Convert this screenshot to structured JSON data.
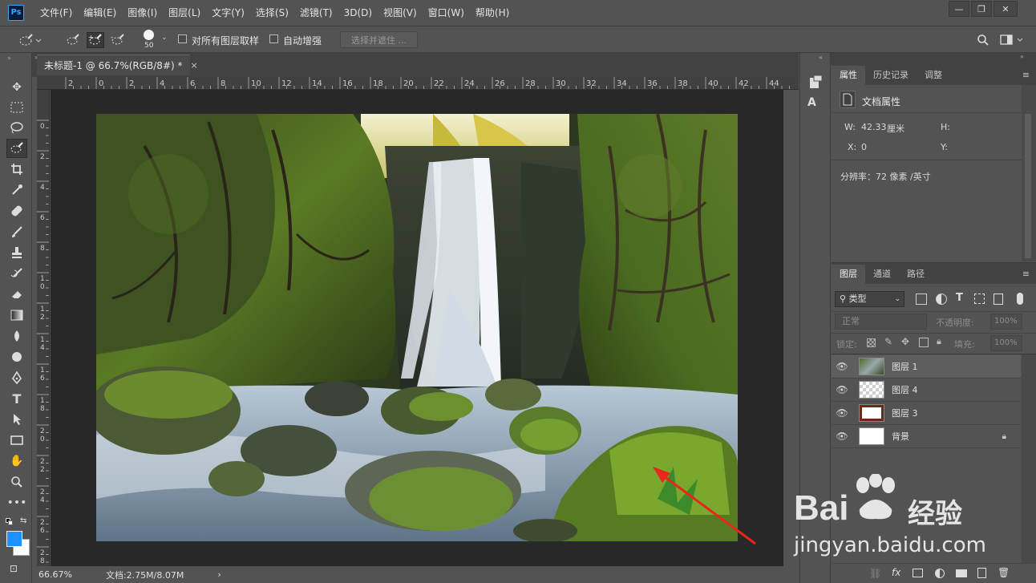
{
  "app": {
    "logo": "Ps"
  },
  "menu": [
    "文件(F)",
    "编辑(E)",
    "图像(I)",
    "图层(L)",
    "文字(Y)",
    "选择(S)",
    "滤镜(T)",
    "3D(D)",
    "视图(V)",
    "窗口(W)",
    "帮助(H)"
  ],
  "window_controls": {
    "minimize": "—",
    "restore": "❐",
    "close": "✕"
  },
  "options": {
    "brush_size": "50",
    "sample_all_layers": "对所有图层取样",
    "auto_enhance": "自动增强",
    "select_and_mask": "选择并遮住 ..."
  },
  "document": {
    "tab_title": "未标题-1 @ 66.7%(RGB/8#) *",
    "tab_close": "×",
    "ruler_h": [
      "2",
      "0",
      "2",
      "4",
      "6",
      "8",
      "10",
      "12",
      "14",
      "16",
      "18",
      "20",
      "22",
      "24",
      "26",
      "28",
      "30",
      "32",
      "34",
      "36",
      "38",
      "40",
      "42",
      "44"
    ],
    "ruler_v": [
      "0",
      "2",
      "4",
      "6",
      "8",
      "1 0",
      "1 2",
      "1 4",
      "1 6",
      "1 8",
      "2 0",
      "2 2",
      "2 4",
      "2 6",
      "2 8"
    ],
    "zoom": "66.67%",
    "doc_size": "文档:2.75M/8.07M",
    "status_arrow": "›"
  },
  "properties": {
    "tabs": [
      "属性",
      "历史记录",
      "调整"
    ],
    "header": "文档属性",
    "width_label": "W:",
    "width_value": "42.33",
    "width_unit": "厘米",
    "height_label": "H:",
    "x_label": "X:",
    "x_value": "0",
    "y_label": "Y:",
    "resolution": "分辨率：72 像素 /英寸"
  },
  "layers_panel": {
    "tabs": [
      "图层",
      "通道",
      "路径"
    ],
    "filter_kind": "类型",
    "blend_mode": "正常",
    "opacity_label": "不透明度:",
    "opacity_value": "100%",
    "lock_label": "锁定:",
    "fill_label": "填充:",
    "fill_value": "100%",
    "layers": [
      {
        "name": "图层 1"
      },
      {
        "name": "图层 4"
      },
      {
        "name": "图层 3"
      },
      {
        "name": "背景"
      }
    ]
  },
  "watermark": {
    "brand": "Bai",
    "brand2": "经验",
    "url": "jingyan.baidu.com"
  },
  "colors": {
    "accent": "#31a8ff",
    "foreground": "#1e90ff",
    "annotation_arrow": "#e8261a"
  }
}
